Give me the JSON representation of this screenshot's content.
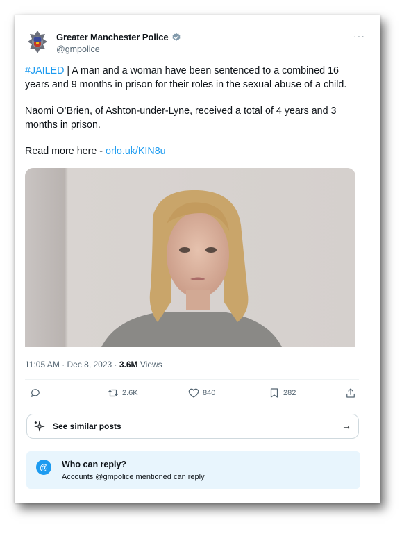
{
  "account": {
    "display_name": "Greater Manchester Police",
    "handle": "@gmpolice",
    "verified": true
  },
  "more_label": "···",
  "tweet": {
    "hashtag": "#JAILED",
    "para1_rest": " | A man and a woman have been sentenced to a combined 16 years and 9 months in prison for their roles in the sexual abuse of a child.",
    "para2": "Naomi O’Brien, of Ashton-under-Lyne, received a total of 4 years and 3 months in prison.",
    "para3_prefix": "Read more here - ",
    "link_text": "orlo.uk/KIN8u"
  },
  "meta": {
    "time": "11:05 AM · Dec 8, 2023 · ",
    "views_count": "3.6M",
    "views_label": " Views"
  },
  "actions": {
    "reply_count": "",
    "retweet_count": "2.6K",
    "like_count": "840",
    "bookmark_count": "282"
  },
  "similar": {
    "label": "See similar posts",
    "arrow": "→"
  },
  "who_can_reply": {
    "icon_text": "@",
    "title": "Who can reply?",
    "subtitle": "Accounts @gmpolice mentioned can reply"
  },
  "colors": {
    "accent": "#1d9bf0",
    "secondary_text": "#536471",
    "reply_box_bg": "#e8f5fd"
  }
}
